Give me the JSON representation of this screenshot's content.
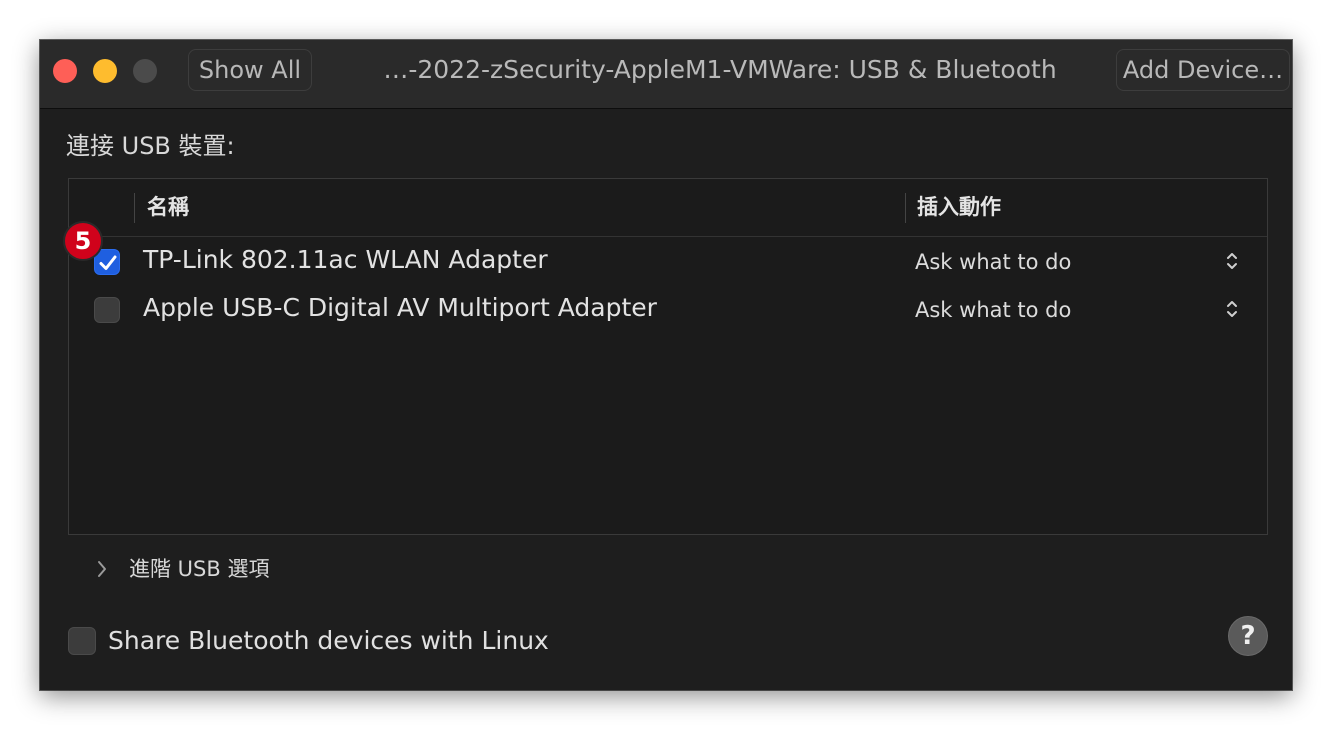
{
  "window": {
    "title": "…-2022-zSecurity-AppleM1-VMWare: USB & Bluetooth",
    "show_all_label": "Show All",
    "add_device_label": "Add Device…"
  },
  "usb": {
    "section_label": "連接 USB 裝置:",
    "columns": {
      "name": "名稱",
      "action": "插入動作"
    },
    "devices": [
      {
        "name": "TP-Link 802.11ac WLAN Adapter",
        "action": "Ask what to do",
        "checked": true
      },
      {
        "name": "Apple USB-C Digital AV Multiport Adapter",
        "action": "Ask what to do",
        "checked": false
      }
    ],
    "advanced_label": "進階 USB 選項"
  },
  "bluetooth": {
    "share_label": "Share Bluetooth devices with Linux",
    "checked": false
  },
  "annotation": {
    "step_number": "5",
    "color": "#d0021b"
  },
  "help": {
    "glyph": "?"
  },
  "colors": {
    "close": "#fe5f57",
    "minimize": "#febc2e",
    "zoom_disabled": "#4b4b4b",
    "checkbox_accent": "#1f5fe0"
  },
  "icons": {
    "checkmark": "checkmark-icon",
    "stepper": "up-down-chevron-icon",
    "disclosure": "chevron-right-icon",
    "help": "question-mark-icon"
  }
}
